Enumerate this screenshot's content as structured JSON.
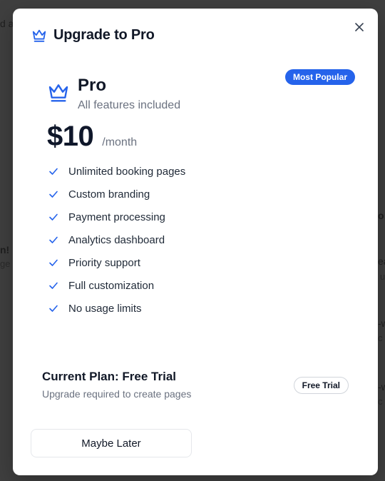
{
  "background": {
    "fragments": [
      {
        "text": "d a"
      },
      {
        "text": "n!"
      },
      {
        "text": "ge"
      },
      {
        "text": "o"
      },
      {
        "text": "ea"
      },
      {
        "text": "u"
      },
      {
        "text": "-w"
      },
      {
        "text": "c"
      },
      {
        "text": "-w"
      },
      {
        "text": "c"
      }
    ]
  },
  "modal": {
    "title": "Upgrade to Pro",
    "close_icon": "close-icon",
    "accent_color": "#2563eb"
  },
  "plan": {
    "name": "Pro",
    "subtitle": "All features included",
    "badge": "Most Popular",
    "price": "$10",
    "period": "/month",
    "icon": "crown-icon",
    "features": [
      {
        "label": "Unlimited booking pages"
      },
      {
        "label": "Custom branding"
      },
      {
        "label": "Payment processing"
      },
      {
        "label": "Analytics dashboard"
      },
      {
        "label": "Priority support"
      },
      {
        "label": "Full customization"
      },
      {
        "label": "No usage limits"
      }
    ]
  },
  "current_plan": {
    "title": "Current Plan: Free Trial",
    "subtitle": "Upgrade required to create pages",
    "badge": "Free Trial"
  },
  "actions": {
    "maybe_later_label": "Maybe Later"
  }
}
